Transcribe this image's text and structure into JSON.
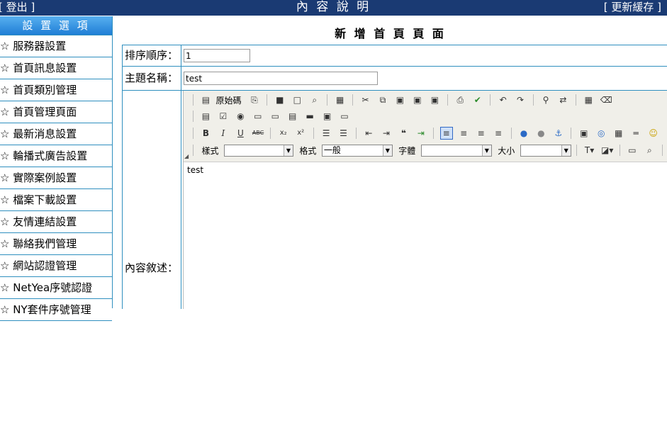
{
  "header": {
    "logout": "[ 登出 ]",
    "title": "內 容 說 明",
    "refresh": "[ 更新緩存 ]"
  },
  "sidebar": {
    "heading": "設 置 選 項",
    "star": "☆",
    "items": [
      "服務器設置",
      "首頁訊息設置",
      "首頁類別管理",
      "首頁管理頁面",
      "最新消息設置",
      "輪播式廣告設置",
      "實際案例設置",
      "檔案下載設置",
      "友情連結設置",
      "聯絡我們管理",
      "網站認證管理",
      "NetYea序號認證",
      "NY套件序號管理"
    ]
  },
  "main": {
    "title": "新 增 首 頁 頁 面",
    "sort_label": "排序順序：",
    "sort_value": "1",
    "subject_label": "主題名稱：",
    "subject_value": "test",
    "content_label": "內容敘述："
  },
  "editor": {
    "source_label": "原始碼",
    "style_label": "樣式",
    "format_label": "格式",
    "format_value": "一般",
    "font_label": "字體",
    "size_label": "大小",
    "content": "test"
  }
}
